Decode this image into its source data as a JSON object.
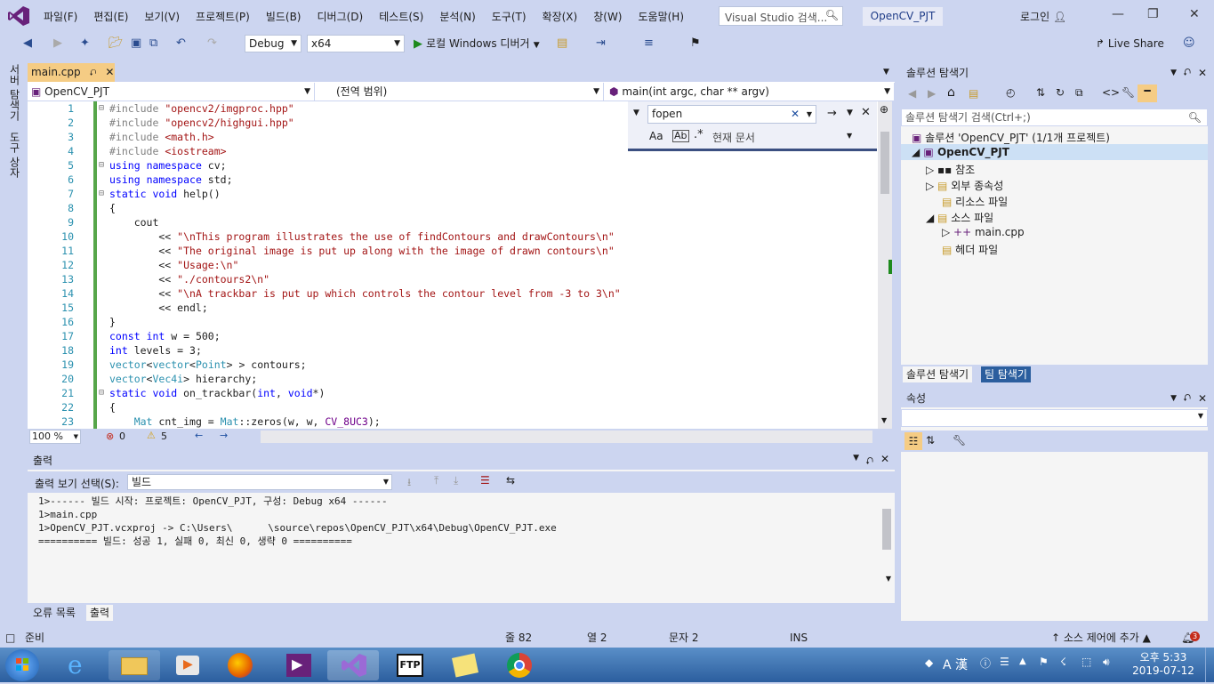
{
  "menu": [
    "파일(F)",
    "편집(E)",
    "보기(V)",
    "프로젝트(P)",
    "빌드(B)",
    "디버그(D)",
    "테스트(S)",
    "분석(N)",
    "도구(T)",
    "확장(X)",
    "창(W)",
    "도움말(H)"
  ],
  "search_placeholder": "Visual Studio 검색...",
  "project_title": "OpenCV_PJT",
  "login": "로그인",
  "toolbar": {
    "config": "Debug",
    "platform": "x64",
    "run": "로컬 Windows 디버거",
    "liveshare": "Live Share"
  },
  "left_tabs": [
    "서버 탐색기",
    "도구 상자"
  ],
  "doc_tab": "main.cpp",
  "nav": {
    "project": "OpenCV_PJT",
    "scope": "(전역 범위)",
    "member": "main(int argc, char ** argv)"
  },
  "find": {
    "text": "fopen",
    "scope": "현재 문서"
  },
  "code_lines": [
    {
      "n": "1",
      "t": "#include \"opencv2/imgproc.hpp\""
    },
    {
      "n": "2",
      "t": "#include \"opencv2/highgui.hpp\""
    },
    {
      "n": "3",
      "t": "#include <math.h>"
    },
    {
      "n": "4",
      "t": "#include <iostream>"
    },
    {
      "n": "5",
      "t": "using namespace cv;"
    },
    {
      "n": "6",
      "t": "using namespace std;"
    },
    {
      "n": "7",
      "t": "static void help()"
    },
    {
      "n": "8",
      "t": "{"
    },
    {
      "n": "9",
      "t": "    cout"
    },
    {
      "n": "10",
      "t": "        << \"\\nThis program illustrates the use of findContours and drawContours\\n\""
    },
    {
      "n": "11",
      "t": "        << \"The original image is put up along with the image of drawn contours\\n\""
    },
    {
      "n": "12",
      "t": "        << \"Usage:\\n\""
    },
    {
      "n": "13",
      "t": "        << \"./contours2\\n\""
    },
    {
      "n": "14",
      "t": "        << \"\\nA trackbar is put up which controls the contour level from -3 to 3\\n\""
    },
    {
      "n": "15",
      "t": "        << endl;"
    },
    {
      "n": "16",
      "t": "}"
    },
    {
      "n": "17",
      "t": "const int w = 500;"
    },
    {
      "n": "18",
      "t": "int levels = 3;"
    },
    {
      "n": "19",
      "t": "vector<vector<Point> > contours;"
    },
    {
      "n": "20",
      "t": "vector<Vec4i> hierarchy;"
    },
    {
      "n": "21",
      "t": "static void on_trackbar(int, void*)"
    },
    {
      "n": "22",
      "t": "{"
    },
    {
      "n": "23",
      "t": "    Mat cnt_img = Mat::zeros(w, w, CV_8UC3);"
    }
  ],
  "editor_status": {
    "zoom": "100 %",
    "errors": "0",
    "warnings": "5"
  },
  "output": {
    "title": "출력",
    "show_label": "출력 보기 선택(S):",
    "source": "빌드",
    "lines": [
      "1>------ 빌드 시작: 프로젝트: OpenCV_PJT, 구성: Debug x64 ------",
      "1>main.cpp",
      "1>OpenCV_PJT.vcxproj -> C:\\Users\\      \\source\\repos\\OpenCV_PJT\\x64\\Debug\\OpenCV_PJT.exe",
      "========== 빌드: 성공 1, 실패 0, 최신 0, 생략 0 =========="
    ]
  },
  "bottom_tabs": [
    "오류 목록",
    "출력"
  ],
  "solution": {
    "title": "솔루션 탐색기",
    "search": "솔루션 탐색기 검색(Ctrl+;)",
    "root": "솔루션 'OpenCV_PJT' (1/1개 프로젝트)",
    "project": "OpenCV_PJT",
    "items": [
      "참조",
      "외부 종속성",
      "리소스 파일",
      "소스 파일",
      "main.cpp",
      "헤더 파일"
    ],
    "tabs": [
      "솔루션 탐색기",
      "팀 탐색기"
    ]
  },
  "properties_title": "속성",
  "status": {
    "ready": "준비",
    "line": "줄 82",
    "col": "열 2",
    "char": "문자 2",
    "ins": "INS",
    "scm": "소스 제어에 추가",
    "notif": "3"
  },
  "clock": {
    "time": "오후 5:33",
    "date": "2019-07-12"
  },
  "tray_ime": "A 漢"
}
